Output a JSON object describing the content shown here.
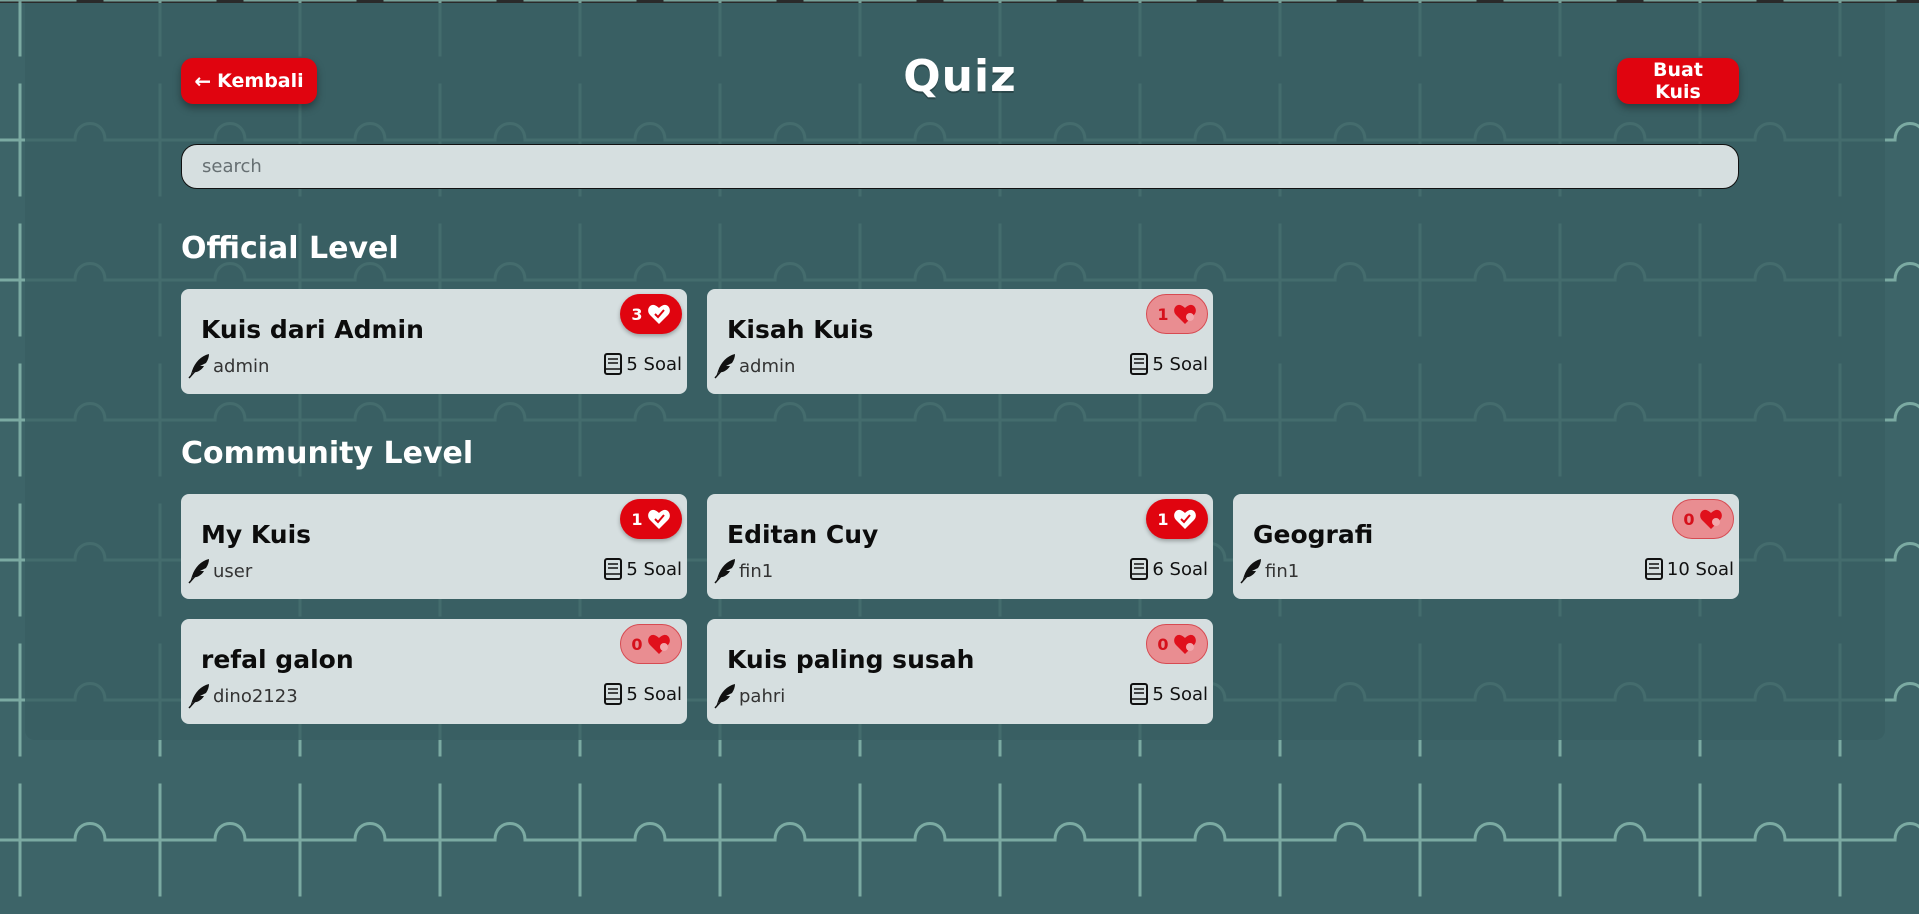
{
  "header": {
    "back_label": "Kembali",
    "title": "Quiz",
    "create_label": "Buat Kuis"
  },
  "search": {
    "placeholder": "search",
    "value": ""
  },
  "colors": {
    "background": "#3d6468",
    "accent": "#e0040f",
    "card": "#d6dfe0",
    "like_inactive": "#e98d91"
  },
  "sections": {
    "official": {
      "title": "Official Level",
      "cards": [
        {
          "title": "Kuis dari Admin",
          "author": "admin",
          "likes": "3",
          "liked": true,
          "soal": "5 Soal"
        },
        {
          "title": "Kisah Kuis",
          "author": "admin",
          "likes": "1",
          "liked": false,
          "soal": "5 Soal"
        }
      ]
    },
    "community": {
      "title": "Community Level",
      "cards": [
        {
          "title": "My Kuis",
          "author": "user",
          "likes": "1",
          "liked": true,
          "soal": "5 Soal"
        },
        {
          "title": "Editan Cuy",
          "author": "fin1",
          "likes": "1",
          "liked": true,
          "soal": "6 Soal"
        },
        {
          "title": "Geografi",
          "author": "fin1",
          "likes": "0",
          "liked": false,
          "soal": "10 Soal"
        },
        {
          "title": "refal galon",
          "author": "dino2123",
          "likes": "0",
          "liked": false,
          "soal": "5 Soal"
        },
        {
          "title": "Kuis paling susah",
          "author": "pahri",
          "likes": "0",
          "liked": false,
          "soal": "5 Soal"
        }
      ]
    }
  }
}
